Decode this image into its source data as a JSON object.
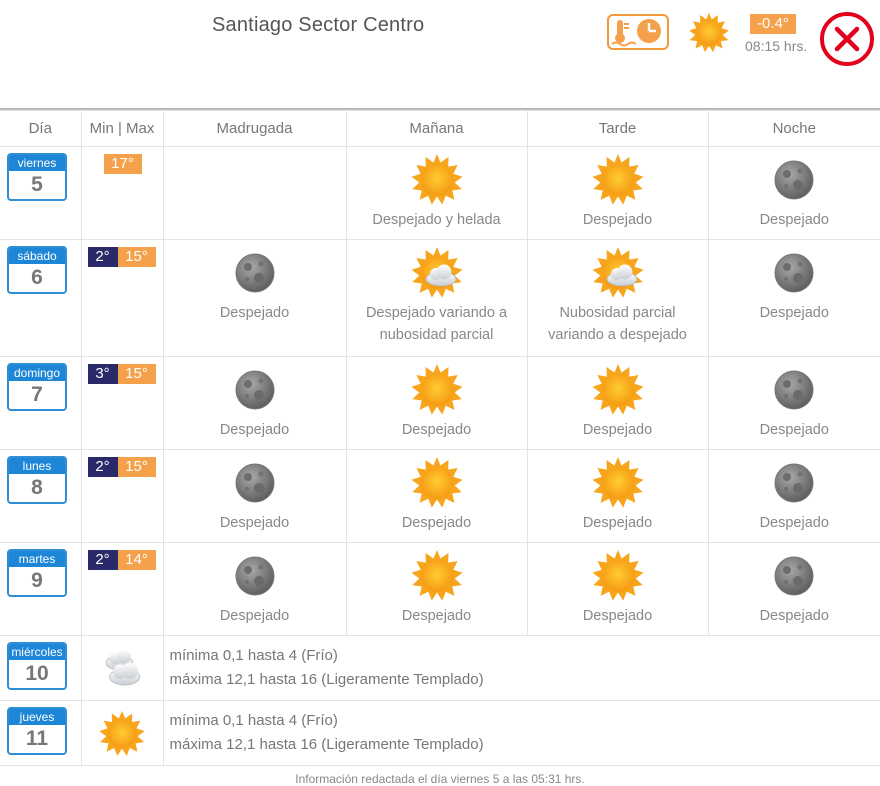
{
  "header": {
    "location": "Santiago Sector Centro",
    "current_temp": "-0.4°",
    "current_time": "08:15 hrs.",
    "icons": {
      "thermo": "thermometer-clock-icon",
      "current": "sun-icon",
      "close": "close-circle-icon"
    }
  },
  "colors": {
    "accent_orange": "#f5a04a",
    "day_blue": "#1e86d6",
    "min_navy": "#2a2a6a",
    "close_red": "#e3001b"
  },
  "columns": [
    "Día",
    "Min | Max",
    "Madrugada",
    "Mañana",
    "Tarde",
    "Noche"
  ],
  "days": [
    {
      "name": "viernes",
      "num": "5",
      "min": "",
      "max": "17°",
      "periods": [
        {
          "icon": "",
          "label": ""
        },
        {
          "icon": "sun",
          "label": "Despejado y helada"
        },
        {
          "icon": "sun",
          "label": "Despejado"
        },
        {
          "icon": "moon",
          "label": "Despejado"
        }
      ]
    },
    {
      "name": "sábado",
      "num": "6",
      "min": "2°",
      "max": "15°",
      "periods": [
        {
          "icon": "moon",
          "label": "Despejado"
        },
        {
          "icon": "sun-cloud",
          "label": "Despejado variando a nubosidad parcial"
        },
        {
          "icon": "sun-cloud",
          "label": "Nubosidad parcial variando a despejado"
        },
        {
          "icon": "moon",
          "label": "Despejado"
        }
      ]
    },
    {
      "name": "domingo",
      "num": "7",
      "min": "3°",
      "max": "15°",
      "periods": [
        {
          "icon": "moon",
          "label": "Despejado"
        },
        {
          "icon": "sun",
          "label": "Despejado"
        },
        {
          "icon": "sun",
          "label": "Despejado"
        },
        {
          "icon": "moon",
          "label": "Despejado"
        }
      ]
    },
    {
      "name": "lunes",
      "num": "8",
      "min": "2°",
      "max": "15°",
      "periods": [
        {
          "icon": "moon",
          "label": "Despejado"
        },
        {
          "icon": "sun",
          "label": "Despejado"
        },
        {
          "icon": "sun",
          "label": "Despejado"
        },
        {
          "icon": "moon",
          "label": "Despejado"
        }
      ]
    },
    {
      "name": "martes",
      "num": "9",
      "min": "2°",
      "max": "14°",
      "periods": [
        {
          "icon": "moon",
          "label": "Despejado"
        },
        {
          "icon": "sun",
          "label": "Despejado"
        },
        {
          "icon": "sun",
          "label": "Despejado"
        },
        {
          "icon": "moon",
          "label": "Despejado"
        }
      ]
    }
  ],
  "extended": [
    {
      "name": "miércoles",
      "num": "10",
      "icon": "clouds",
      "min_text": "mínima 0,1 hasta 4 (Frío)",
      "max_text": "máxima 12,1 hasta 16 (Ligeramente Templado)"
    },
    {
      "name": "jueves",
      "num": "11",
      "icon": "sun",
      "min_text": "mínima 0,1 hasta 4 (Frío)",
      "max_text": "máxima 12,1 hasta 16 (Ligeramente Templado)"
    }
  ],
  "footer": "Información redactada el día viernes 5 a las 05:31 hrs."
}
